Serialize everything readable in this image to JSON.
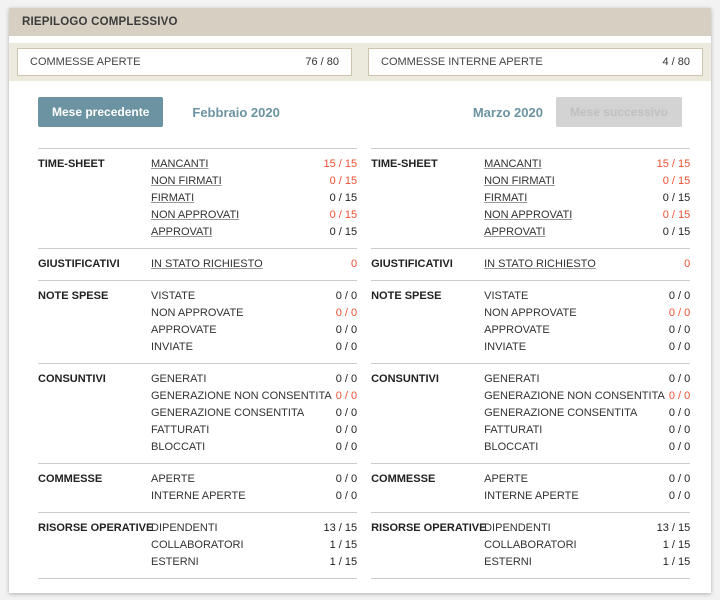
{
  "header": {
    "title": "RIEPILOGO COMPLESSIVO"
  },
  "summary_boxes": [
    {
      "label": "COMMESSE APERTE",
      "value": "76 / 80"
    },
    {
      "label": "COMMESSE INTERNE APERTE",
      "value": "4 / 80"
    }
  ],
  "nav": {
    "prev_button_label": "Mese precedente",
    "next_button_label": "Mese successivo"
  },
  "colors": {
    "header_bg": "#d6cfc2",
    "strip_bg": "#ece9dd",
    "accent_teal": "#6b93a1",
    "alert_red": "#ee4f33",
    "disabled_button_bg": "#d3d3d3",
    "disabled_button_text": "#c0c0c0"
  },
  "columns": [
    {
      "month_label": "Febbraio 2020",
      "sections": [
        {
          "title": "TIME-SHEET",
          "rows": [
            {
              "label": "MANCANTI",
              "value": "15 / 15",
              "link": true,
              "alert": true
            },
            {
              "label": "NON FIRMATI",
              "value": "0 / 15",
              "link": true,
              "alert": true
            },
            {
              "label": "FIRMATI",
              "value": "0 / 15",
              "link": true,
              "alert": false
            },
            {
              "label": "NON APPROVATI",
              "value": "0 / 15",
              "link": true,
              "alert": true
            },
            {
              "label": "APPROVATI",
              "value": "0 / 15",
              "link": true,
              "alert": false
            }
          ]
        },
        {
          "title": "GIUSTIFICATIVI",
          "rows": [
            {
              "label": "IN STATO RICHIESTO",
              "value": "0",
              "link": true,
              "alert": true
            }
          ]
        },
        {
          "title": "NOTE SPESE",
          "rows": [
            {
              "label": "VISTATE",
              "value": "0 / 0",
              "link": false,
              "alert": false
            },
            {
              "label": "NON APPROVATE",
              "value": "0 / 0",
              "link": false,
              "alert": true
            },
            {
              "label": "APPROVATE",
              "value": "0 / 0",
              "link": false,
              "alert": false
            },
            {
              "label": "INVIATE",
              "value": "0 / 0",
              "link": false,
              "alert": false
            }
          ]
        },
        {
          "title": "CONSUNTIVI",
          "rows": [
            {
              "label": "GENERATI",
              "value": "0 / 0",
              "link": false,
              "alert": false
            },
            {
              "label": "GENERAZIONE NON CONSENTITA",
              "value": "0 / 0",
              "link": false,
              "alert": true
            },
            {
              "label": "GENERAZIONE CONSENTITA",
              "value": "0 / 0",
              "link": false,
              "alert": false
            },
            {
              "label": "FATTURATI",
              "value": "0 / 0",
              "link": false,
              "alert": false
            },
            {
              "label": "BLOCCATI",
              "value": "0 / 0",
              "link": false,
              "alert": false
            }
          ]
        },
        {
          "title": "COMMESSE",
          "rows": [
            {
              "label": "APERTE",
              "value": "0 / 0",
              "link": false,
              "alert": false
            },
            {
              "label": "INTERNE APERTE",
              "value": "0 / 0",
              "link": false,
              "alert": false
            }
          ]
        },
        {
          "title": "RISORSE OPERATIVE",
          "rows": [
            {
              "label": "DIPENDENTI",
              "value": "13 / 15",
              "link": false,
              "alert": false
            },
            {
              "label": "COLLABORATORI",
              "value": "1 / 15",
              "link": false,
              "alert": false
            },
            {
              "label": "ESTERNI",
              "value": "1 / 15",
              "link": false,
              "alert": false
            }
          ]
        }
      ]
    },
    {
      "month_label": "Marzo 2020",
      "sections": [
        {
          "title": "TIME-SHEET",
          "rows": [
            {
              "label": "MANCANTI",
              "value": "15 / 15",
              "link": true,
              "alert": true
            },
            {
              "label": "NON FIRMATI",
              "value": "0 / 15",
              "link": true,
              "alert": true
            },
            {
              "label": "FIRMATI",
              "value": "0 / 15",
              "link": true,
              "alert": false
            },
            {
              "label": "NON APPROVATI",
              "value": "0 / 15",
              "link": true,
              "alert": true
            },
            {
              "label": "APPROVATI",
              "value": "0 / 15",
              "link": true,
              "alert": false
            }
          ]
        },
        {
          "title": "GIUSTIFICATIVI",
          "rows": [
            {
              "label": "IN STATO RICHIESTO",
              "value": "0",
              "link": true,
              "alert": true
            }
          ]
        },
        {
          "title": "NOTE SPESE",
          "rows": [
            {
              "label": "VISTATE",
              "value": "0 / 0",
              "link": false,
              "alert": false
            },
            {
              "label": "NON APPROVATE",
              "value": "0 / 0",
              "link": false,
              "alert": true
            },
            {
              "label": "APPROVATE",
              "value": "0 / 0",
              "link": false,
              "alert": false
            },
            {
              "label": "INVIATE",
              "value": "0 / 0",
              "link": false,
              "alert": false
            }
          ]
        },
        {
          "title": "CONSUNTIVI",
          "rows": [
            {
              "label": "GENERATI",
              "value": "0 / 0",
              "link": false,
              "alert": false
            },
            {
              "label": "GENERAZIONE NON CONSENTITA",
              "value": "0 / 0",
              "link": false,
              "alert": true
            },
            {
              "label": "GENERAZIONE CONSENTITA",
              "value": "0 / 0",
              "link": false,
              "alert": false
            },
            {
              "label": "FATTURATI",
              "value": "0 / 0",
              "link": false,
              "alert": false
            },
            {
              "label": "BLOCCATI",
              "value": "0 / 0",
              "link": false,
              "alert": false
            }
          ]
        },
        {
          "title": "COMMESSE",
          "rows": [
            {
              "label": "APERTE",
              "value": "0 / 0",
              "link": false,
              "alert": false
            },
            {
              "label": "INTERNE APERTE",
              "value": "0 / 0",
              "link": false,
              "alert": false
            }
          ]
        },
        {
          "title": "RISORSE OPERATIVE",
          "rows": [
            {
              "label": "DIPENDENTI",
              "value": "13 / 15",
              "link": false,
              "alert": false
            },
            {
              "label": "COLLABORATORI",
              "value": "1 / 15",
              "link": false,
              "alert": false
            },
            {
              "label": "ESTERNI",
              "value": "1 / 15",
              "link": false,
              "alert": false
            }
          ]
        }
      ]
    }
  ]
}
